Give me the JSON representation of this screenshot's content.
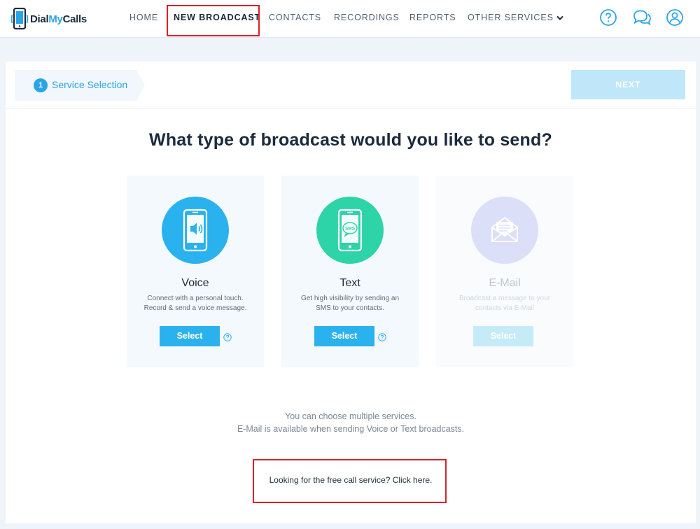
{
  "brand": {
    "logo_part1": "Dial",
    "logo_part2": "My",
    "logo_part3": "Calls"
  },
  "nav": {
    "items": [
      {
        "label": "HOME",
        "active": false
      },
      {
        "label": "NEW BROADCAST",
        "active": true
      },
      {
        "label": "CONTACTS",
        "active": false
      },
      {
        "label": "RECORDINGS",
        "active": false
      },
      {
        "label": "REPORTS",
        "active": false
      },
      {
        "label": "OTHER SERVICES",
        "active": false,
        "has_dropdown": true
      }
    ],
    "icons": [
      "help-icon",
      "chat-icon",
      "account-icon"
    ]
  },
  "wizard": {
    "step_number": "1",
    "step_label": "Service Selection",
    "next_label": "NEXT"
  },
  "headline": "What type of broadcast would you like to send?",
  "services": [
    {
      "name": "Voice",
      "description_line1": "Connect with a personal touch.",
      "description_line2": "Record & send a voice message.",
      "select_label": "Select",
      "enabled": true,
      "icon": "phone-speaker-icon",
      "color": "#2ab2ee"
    },
    {
      "name": "Text",
      "description_line1": "Get high visibility by sending an",
      "description_line2": "SMS to your contacts.",
      "select_label": "Select",
      "enabled": true,
      "icon": "phone-sms-icon",
      "sms_badge": "SMS",
      "color": "#2dd4a8"
    },
    {
      "name": "E-Mail",
      "description_line1": "Broadcast a message to your",
      "description_line2": "contacts via E-Mail",
      "select_label": "Select",
      "enabled": false,
      "icon": "envelope-icon",
      "color": "#d8dcf7"
    }
  ],
  "info": {
    "line1": "You can choose multiple services.",
    "line2": "E-Mail is available when sending Voice or Text broadcasts."
  },
  "free_call_link": "Looking for the free call service? Click here.",
  "colors": {
    "accent": "#2aa4e8",
    "annotation_red": "#d6222a",
    "background": "#eef4f9"
  }
}
